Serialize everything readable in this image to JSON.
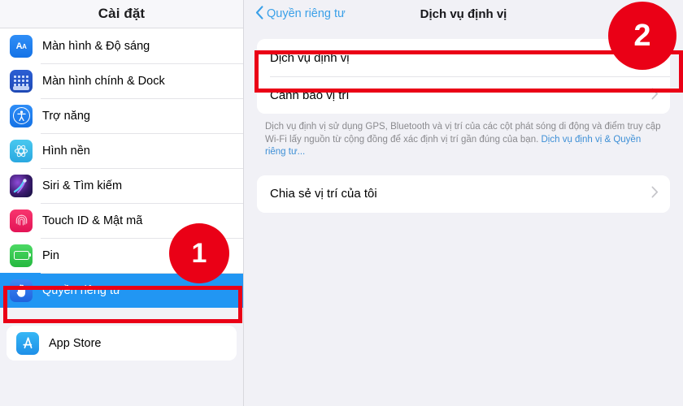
{
  "sidebar": {
    "title": "Cài đặt",
    "groups": [
      {
        "items": [
          {
            "label": "Màn hình & Độ sáng",
            "icon": "display-brightness-icon"
          },
          {
            "label": "Màn hình chính & Dock",
            "icon": "home-screen-dock-icon"
          },
          {
            "label": "Trợ năng",
            "icon": "accessibility-icon"
          },
          {
            "label": "Hình nền",
            "icon": "wallpaper-icon"
          },
          {
            "label": "Siri & Tìm kiếm",
            "icon": "siri-icon"
          },
          {
            "label": "Touch ID & Mật mã",
            "icon": "touch-id-icon"
          },
          {
            "label": "Pin",
            "icon": "battery-icon"
          },
          {
            "label": "Quyền riêng tư",
            "icon": "privacy-hand-icon",
            "selected": true
          }
        ]
      },
      {
        "items": [
          {
            "label": "App Store",
            "icon": "app-store-icon"
          }
        ]
      }
    ]
  },
  "detail": {
    "back_label": "Quyền riêng tư",
    "title": "Dịch vụ định vị",
    "rows": {
      "location_services": {
        "label": "Dịch vụ định vị",
        "toggle_state": "off"
      },
      "location_alerts": {
        "label": "Cảnh báo vị trí"
      },
      "share_my_location": {
        "label": "Chia sẻ vị trí của tôi"
      }
    },
    "footnote": {
      "text": "Dịch vụ định vị sử dụng GPS, Bluetooth và vị trí của các cột phát sóng di động và điểm truy cập Wi-Fi lấy nguồn từ cộng đồng để xác định vị trí gần đúng của bạn.",
      "link": "Dịch vụ định vị & Quyền riêng tư..."
    }
  },
  "annotations": {
    "step_1": "1",
    "step_2": "2",
    "color": "#ea0016"
  },
  "theme": {
    "accent_blue": "#2196f3",
    "link_blue": "#3d8fd6",
    "background": "#f1f1f6"
  }
}
